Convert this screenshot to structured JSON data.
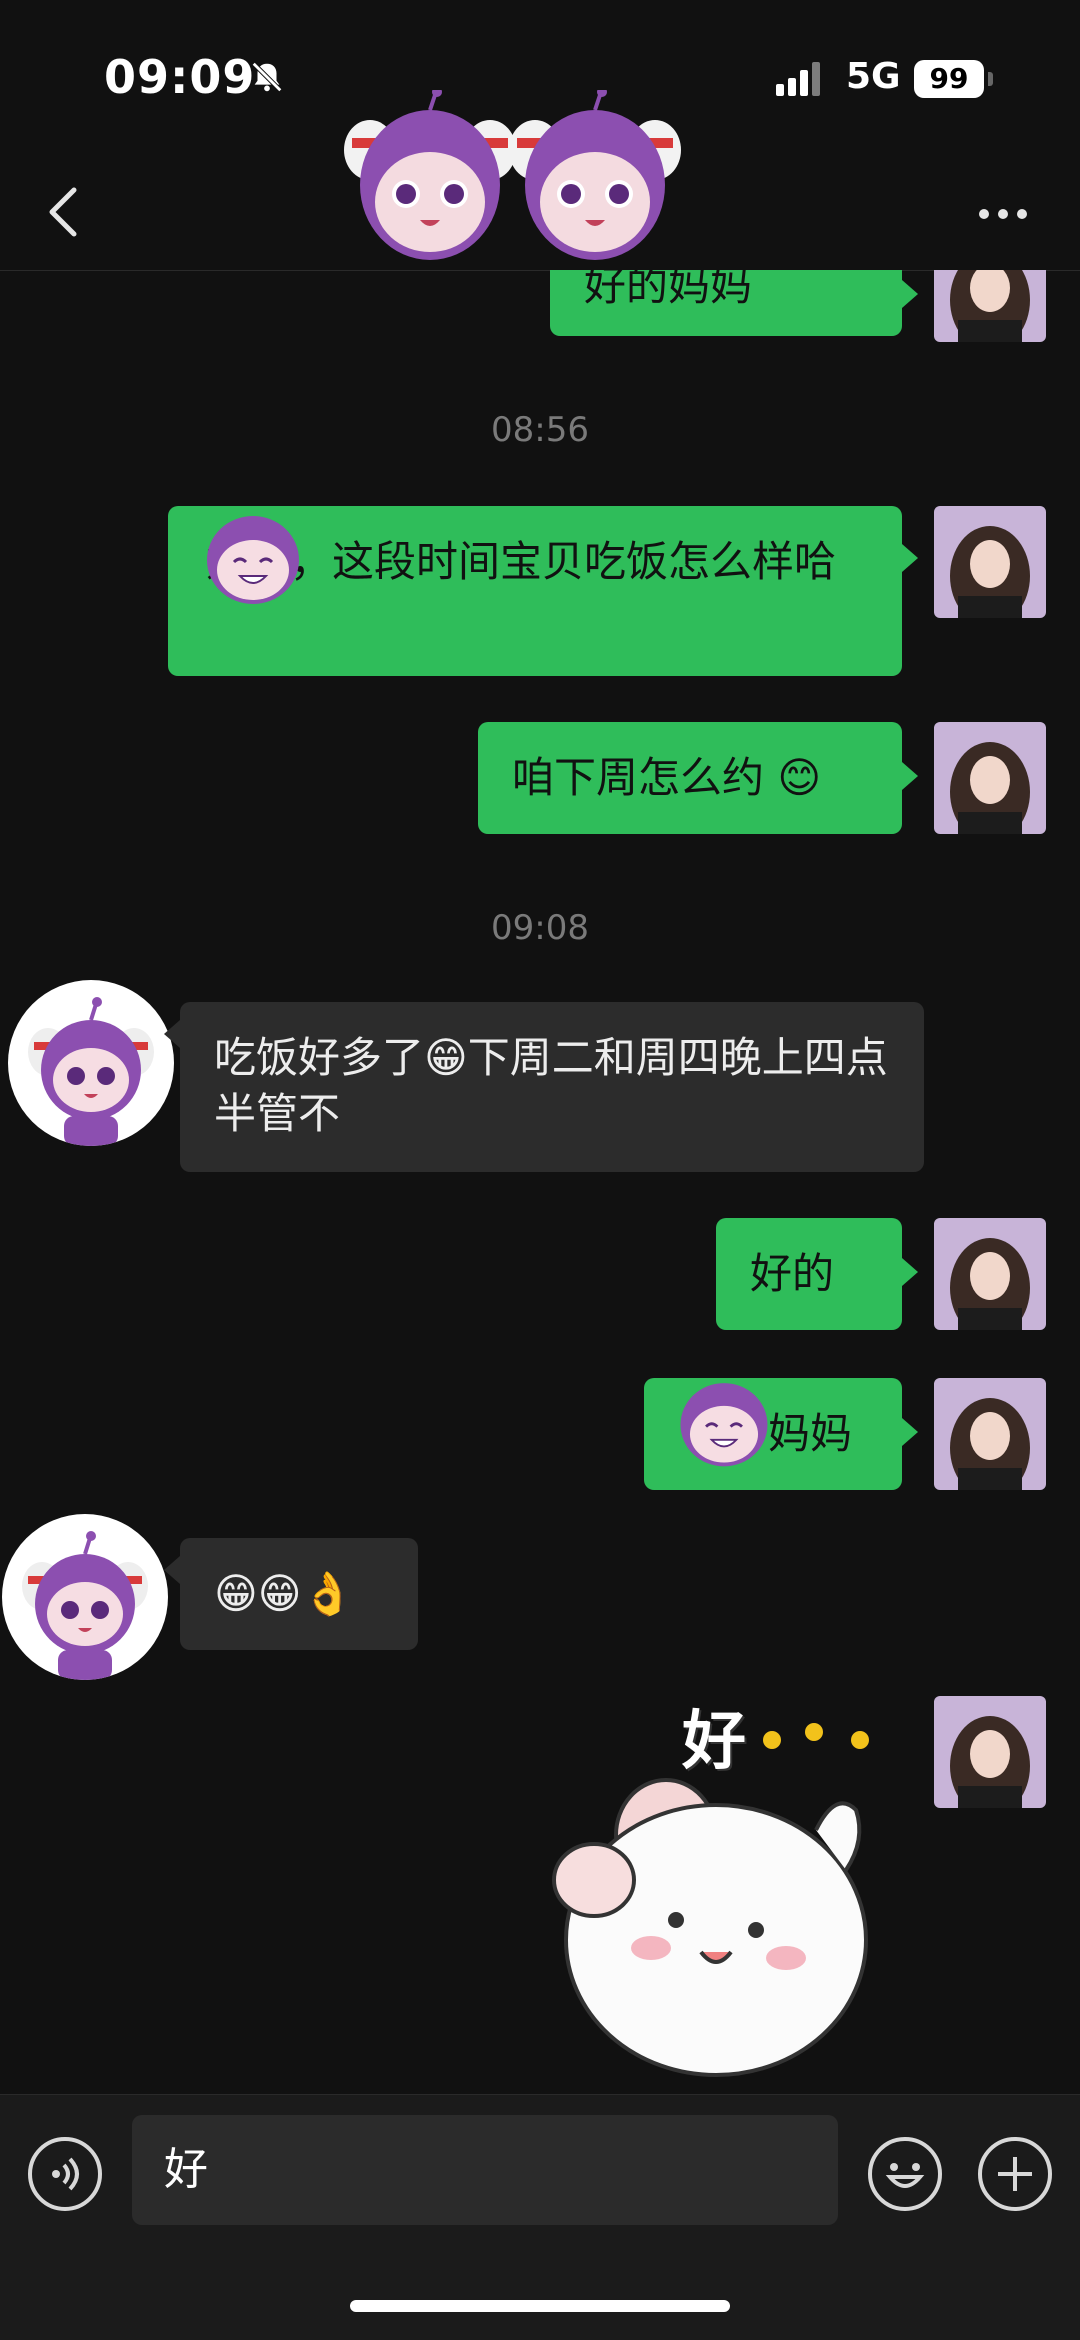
{
  "status_bar": {
    "time": "09:09",
    "network": "5G",
    "battery": "99",
    "icons": [
      "bell-muted-icon",
      "signal-icon",
      "battery-icon"
    ]
  },
  "navbar": {
    "icons": [
      "chevron-left-icon",
      "more-horizontal-icon",
      "mascot-sticker-icon"
    ]
  },
  "messages": [
    {
      "side": "right",
      "text": "好的妈妈",
      "partial": true
    },
    {
      "type": "timestamp",
      "text": "08:56"
    },
    {
      "side": "right",
      "text": "妈妈，这段时间宝贝吃饭怎么样哈"
    },
    {
      "side": "right",
      "text": "咱下周怎么约 😊"
    },
    {
      "type": "timestamp",
      "text": "09:08"
    },
    {
      "side": "left",
      "text": "吃饭好多了😁下周二和周四晚上四点半管不"
    },
    {
      "side": "right",
      "text": "好的"
    },
    {
      "side": "right",
      "text": "妈妈"
    },
    {
      "side": "left",
      "text": "😁😁👌"
    },
    {
      "side": "right",
      "type": "sticker",
      "text": "好"
    }
  ],
  "input": {
    "value": "好",
    "icons": [
      "voice-icon",
      "emoji-icon",
      "plus-icon"
    ]
  },
  "colors": {
    "background": "#111111",
    "outgoing_bubble": "#2fbd5a",
    "incoming_bubble": "#2c2c2c",
    "timestamp": "#7a7a7a",
    "mascot": "#8c4fb0"
  }
}
